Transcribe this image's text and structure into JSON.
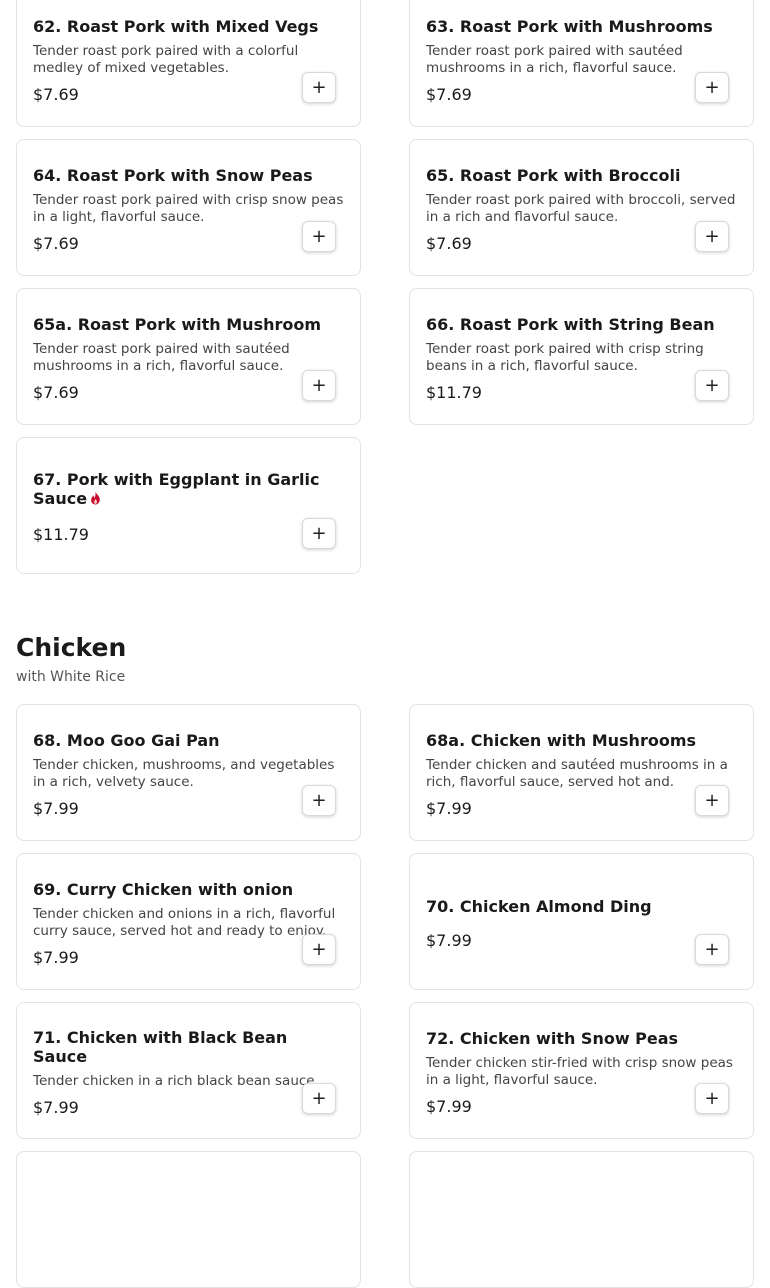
{
  "add_button_label": "+",
  "colors": {
    "spicy_icon": "#c8102e",
    "card_border": "#e3e3e3"
  },
  "pork_items": [
    {
      "title": "62. Roast Pork with Mixed Vegs",
      "description": "Tender roast pork paired with a colorful medley of mixed vegetables.",
      "price": "$7.69"
    },
    {
      "title": "63. Roast Pork with Mushrooms",
      "description": "Tender roast pork paired with sautéed mushrooms in a rich, flavorful sauce.",
      "price": "$7.69"
    },
    {
      "title": "64. Roast Pork with Snow Peas",
      "description": "Tender roast pork paired with crisp snow peas in a light, flavorful sauce.",
      "price": "$7.69"
    },
    {
      "title": "65. Roast Pork with Broccoli",
      "description": "Tender roast pork paired with broccoli, served in a rich and flavorful sauce.",
      "price": "$7.69"
    },
    {
      "title": "65a. Roast Pork with Mushroom",
      "description": "Tender roast pork paired with sautéed mushrooms in a rich, flavorful sauce.",
      "price": "$7.69"
    },
    {
      "title": "66. Roast Pork with String Bean",
      "description": "Tender roast pork paired with crisp string beans in a rich, flavorful sauce.",
      "price": "$11.79"
    },
    {
      "title": "67. Pork with Eggplant in Garlic Sauce",
      "price": "$11.79",
      "icon": "spicy-flame-icon"
    }
  ],
  "chicken_section": {
    "title": "Chicken",
    "subtitle": "with White Rice",
    "items": [
      {
        "title": "68. Moo Goo Gai Pan",
        "description": "Tender chicken, mushrooms, and vegetables in a rich, velvety sauce.",
        "price": "$7.99"
      },
      {
        "title": "68a. Chicken with Mushrooms",
        "description": "Tender chicken and sautéed mushrooms in a rich, flavorful sauce, served hot and.",
        "price": "$7.99"
      },
      {
        "title": "69. Curry Chicken with onion",
        "description": "Tender chicken and onions in a rich, flavorful curry sauce, served hot and ready to enjoy.",
        "price": "$7.99"
      },
      {
        "title": "70. Chicken Almond Ding",
        "price": "$7.99"
      },
      {
        "title": "71. Chicken with Black Bean Sauce",
        "description": "Tender chicken in a rich black bean sauce.",
        "price": "$7.99"
      },
      {
        "title": "72. Chicken with Snow Peas",
        "description": "Tender chicken stir-fried with crisp snow peas in a light, flavorful sauce.",
        "price": "$7.99"
      }
    ]
  }
}
